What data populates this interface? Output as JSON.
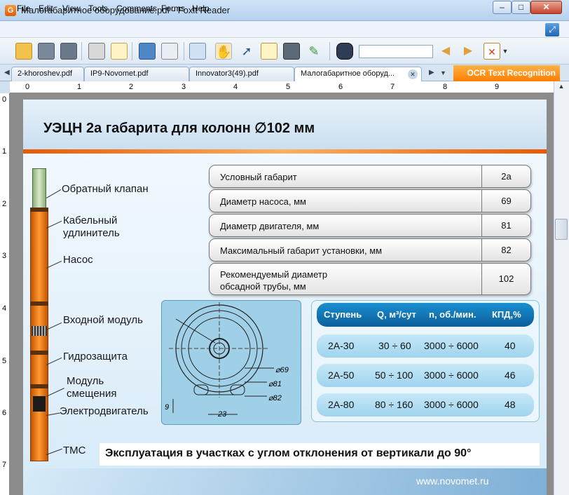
{
  "window": {
    "app_icon": "G",
    "title": "Малогабаритное оборудование.pdf - Foxit Reader",
    "controls": {
      "minimize": "–",
      "maximize": "□",
      "close": "✕"
    }
  },
  "menu": {
    "items": [
      "File",
      "Edit",
      "View",
      "Tools",
      "Comments",
      "Forms",
      "Help"
    ]
  },
  "toolbar": {
    "icons": [
      "open-folder-icon",
      "save-icon",
      "save-as-icon",
      "print-icon",
      "email-icon",
      "screen-icon",
      "find-in-pdf-icon",
      "page-layout-icon",
      "hand-tool-icon",
      "select-arrow-icon",
      "text-select-icon",
      "snapshot-icon",
      "annotate-icon",
      "binoculars-icon",
      "prev-result-icon",
      "next-result-icon",
      "clear-search-icon"
    ],
    "search_value": ""
  },
  "tabs": [
    {
      "label": "2-khoroshev.pdf"
    },
    {
      "label": "IP9-Novomet.pdf"
    },
    {
      "label": "Innovator3(49).pdf"
    },
    {
      "label": "Малогабаритное оборуд..."
    }
  ],
  "ocr_label": "OCR Text Recognition",
  "ruler_top": [
    "0",
    "1",
    "2",
    "3",
    "4",
    "5",
    "6",
    "7",
    "8",
    "9"
  ],
  "ruler_left": [
    "0",
    "1",
    "2",
    "3",
    "4",
    "5",
    "6",
    "7"
  ],
  "slide": {
    "title": "УЭЦН 2а габарита для колонн ∅102 мм",
    "pump_labels": [
      "Обратный клапан",
      "Кабельный удлинитель",
      "Насос",
      "Входной модуль",
      "Гидрозащита",
      "Модуль смещения",
      "Электродвигатель",
      "ТМС"
    ],
    "spec_rows": [
      {
        "label": "Условный габарит",
        "value": "2а"
      },
      {
        "label": "Диаметр насоса, мм",
        "value": "69"
      },
      {
        "label": "Диаметр двигателя, мм",
        "value": "81"
      },
      {
        "label": "Максимальный габарит установки, мм",
        "value": "82"
      },
      {
        "label": "Рекомендуемый  диаметр",
        "label2": "обсадной трубы,  мм",
        "value": "102"
      }
    ],
    "drawing_labels": {
      "d69": "⌀69",
      "d81": "⌀81",
      "d82": "⌀82",
      "w23": "23",
      "h9": "9"
    },
    "stage_header": [
      "Ступень",
      "Q, м³/сут",
      "n, об./мин.",
      "КПД,%"
    ],
    "stage_rows": [
      [
        "2А-30",
        "30 ÷ 60",
        "3000 ÷ 6000",
        "40"
      ],
      [
        "2А-50",
        "50 ÷ 100",
        "3000 ÷ 6000",
        "46"
      ],
      [
        "2А-80",
        "80 ÷ 160",
        "3000 ÷ 6000",
        "48"
      ]
    ],
    "banner": "Эксплуатация в участках с углом отклонения от вертикали до 90°",
    "site": "www.novomet.ru"
  }
}
